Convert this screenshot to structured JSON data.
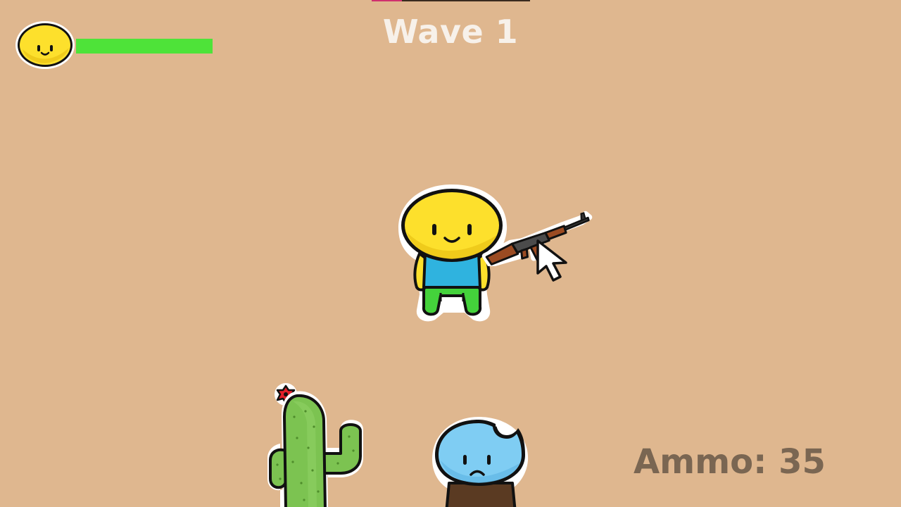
{
  "hud": {
    "wave_label": "Wave 1",
    "ammo_label": "Ammo:",
    "ammo_count": "35",
    "health_fraction": 1.0,
    "wave_progress_fraction": 0.19
  },
  "icons": {
    "player_portrait": "yellow-face-icon",
    "cursor": "mouse-pointer-icon"
  },
  "colors": {
    "background": "#dfb78f",
    "health": "#4ee339",
    "wave_progress": "#d0306e",
    "wave_text": "#f7f1ea",
    "ammo_text": "#7a6652",
    "player_head": "#fde02c",
    "player_shirt": "#2fb3df",
    "player_pants": "#44d23b",
    "enemy_head": "#7fcdf3",
    "cactus": "#7cc351"
  }
}
